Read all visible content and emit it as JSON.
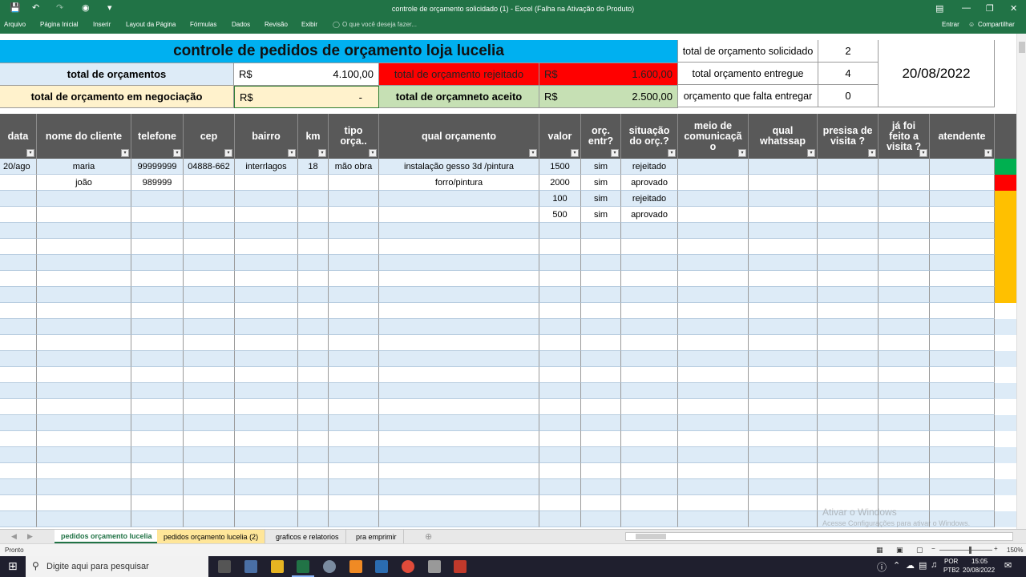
{
  "window": {
    "title": "controle de orçamento solicidado (1) - Excel (Falha na Ativação do Produto)"
  },
  "ribbon": {
    "tabs": [
      "Arquivo",
      "Página Inicial",
      "Inserir",
      "Layout da Página",
      "Fórmulas",
      "Dados",
      "Revisão",
      "Exibir"
    ],
    "tell_me": "O que você deseja fazer...",
    "sign_in": "Entrar",
    "share": "Compartilhar"
  },
  "summary": {
    "title": "controle de pedidos de orçamento loja lucelia",
    "total_label": "total de orçamentos",
    "currency": "R$",
    "total_value": "4.100,00",
    "rejected_label": "total de orçamento rejeitado",
    "rejected_value": "1.600,00",
    "negotiation_label": "total de orçamento em negociação",
    "negotiation_value": "-",
    "accepted_label": "total de orçamneto aceito",
    "accepted_value": "2.500,00",
    "requested_label": "total de orçamento solicidado",
    "requested_value": "2",
    "delivered_label": "total orçamento entregue",
    "delivered_value": "4",
    "pending_label": "orçamento que falta entregar",
    "pending_value": "0",
    "date": "20/08/2022"
  },
  "table": {
    "headers": [
      "data",
      "nome do cliente",
      "telefone",
      "cep",
      "bairro",
      "km",
      "tipo orça..",
      "qual orçamento",
      "valor",
      "orç. entr?",
      "situação do orç.?",
      "meio de comunicaçã o",
      "qual whatssap",
      "presisa de visita ?",
      "já foi feito a visita ?",
      "atendente"
    ],
    "rows": [
      [
        "20/ago",
        "maria",
        "99999999",
        "04888-662",
        "interrlagos",
        "18",
        "mão obra",
        "instalação gesso 3d /pintura",
        "1500",
        "sim",
        "rejeitado",
        "",
        "",
        "",
        "",
        ""
      ],
      [
        "",
        "joão",
        "989999",
        "",
        "",
        "",
        "",
        "forro/pintura",
        "2000",
        "sim",
        "aprovado",
        "",
        "",
        "",
        "",
        ""
      ],
      [
        "",
        "",
        "",
        "",
        "",
        "",
        "",
        "",
        "100",
        "sim",
        "rejeitado",
        "",
        "",
        "",
        "",
        ""
      ],
      [
        "",
        "",
        "",
        "",
        "",
        "",
        "",
        "",
        "500",
        "sim",
        "aprovado",
        "",
        "",
        "",
        "",
        ""
      ]
    ],
    "status_colors": [
      "#00b050",
      "#ff0000",
      "#ffc000",
      "#ffc000",
      "#ffc000",
      "#ffc000",
      "#ffc000",
      "#ffc000",
      "#ffc000"
    ]
  },
  "sheet_tabs": [
    "pedidos orçamento lucelia",
    "pedidos orçamento lucelia  (2)",
    "graficos  e relatorios",
    "pra emprimir"
  ],
  "status": {
    "ready": "Pronto",
    "zoom": "150%"
  },
  "watermark": {
    "line1": "Ativar o Windows",
    "line2": "Acesse Configurações para ativar o Windows."
  },
  "taskbar": {
    "search": "Digite aqui para pesquisar",
    "lang1": "POR",
    "lang2": "PTB2",
    "time": "15:05",
    "date": "20/08/2022"
  },
  "colors": {
    "excel_green": "#217346",
    "title_blue": "#00b0f0",
    "rejected_red": "#ff0000",
    "accepted_green": "#c6e0b4",
    "negotiation_yellow": "#fff2cc",
    "total_blue": "#ddebf7",
    "header_gray": "#595959"
  }
}
